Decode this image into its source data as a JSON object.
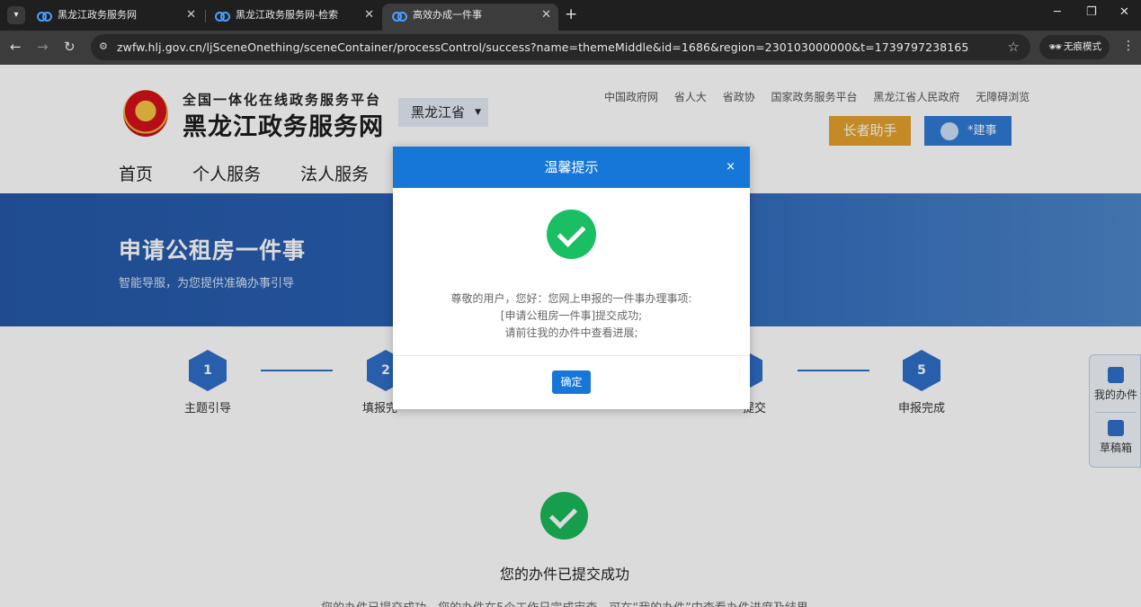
{
  "browser": {
    "tabs": [
      {
        "title": "黑龙江政务服务网"
      },
      {
        "title": "黑龙江政务服务网-检索"
      },
      {
        "title": "高效办成一件事"
      }
    ],
    "new_tab": "+",
    "url": "zwfw.hlj.gov.cn/ljSceneOnething/sceneContainer/processControl/success?name=themeMiddle&id=1686&region=230103000000&t=1739797238165",
    "incognito_label": "无痕模式"
  },
  "header": {
    "platform_subtitle": "全国一体化在线政务服务平台",
    "site_title": "黑龙江政务服务网",
    "region": "黑龙江省",
    "top_links": [
      "中国政府网",
      "省人大",
      "省政协",
      "国家政务服务平台",
      "黑龙江省人民政府",
      "无障碍浏览"
    ],
    "elder_button": "长者助手",
    "user_name": "*建事"
  },
  "nav": {
    "items": [
      "首页",
      "个人服务",
      "法人服务"
    ]
  },
  "banner": {
    "title": "申请公租房一件事",
    "subtitle": "智能导服，为您提供准确办事引导"
  },
  "steps": [
    {
      "num": "1",
      "label": "主题引导"
    },
    {
      "num": "2",
      "label": "填报完"
    },
    {
      "num": "5",
      "label": "申报完成"
    }
  ],
  "step_partial_label": "提交",
  "side_panel": {
    "my_items": "我的办件",
    "drafts": "草稿箱"
  },
  "result": {
    "title": "您的办件已提交成功",
    "desc": "您的办件已提交成功，您的办件在5个工作日完成审查，可在“我的办件”中查看办件进度及结果"
  },
  "modal": {
    "title": "温馨提示",
    "close": "×",
    "line1": "尊敬的用户，您好：您网上申报的一件事办理事项:",
    "line2": "[申请公租房一件事]提交成功;",
    "line3": "请前往我的办件中查看进展;",
    "ok_button": "确定"
  }
}
